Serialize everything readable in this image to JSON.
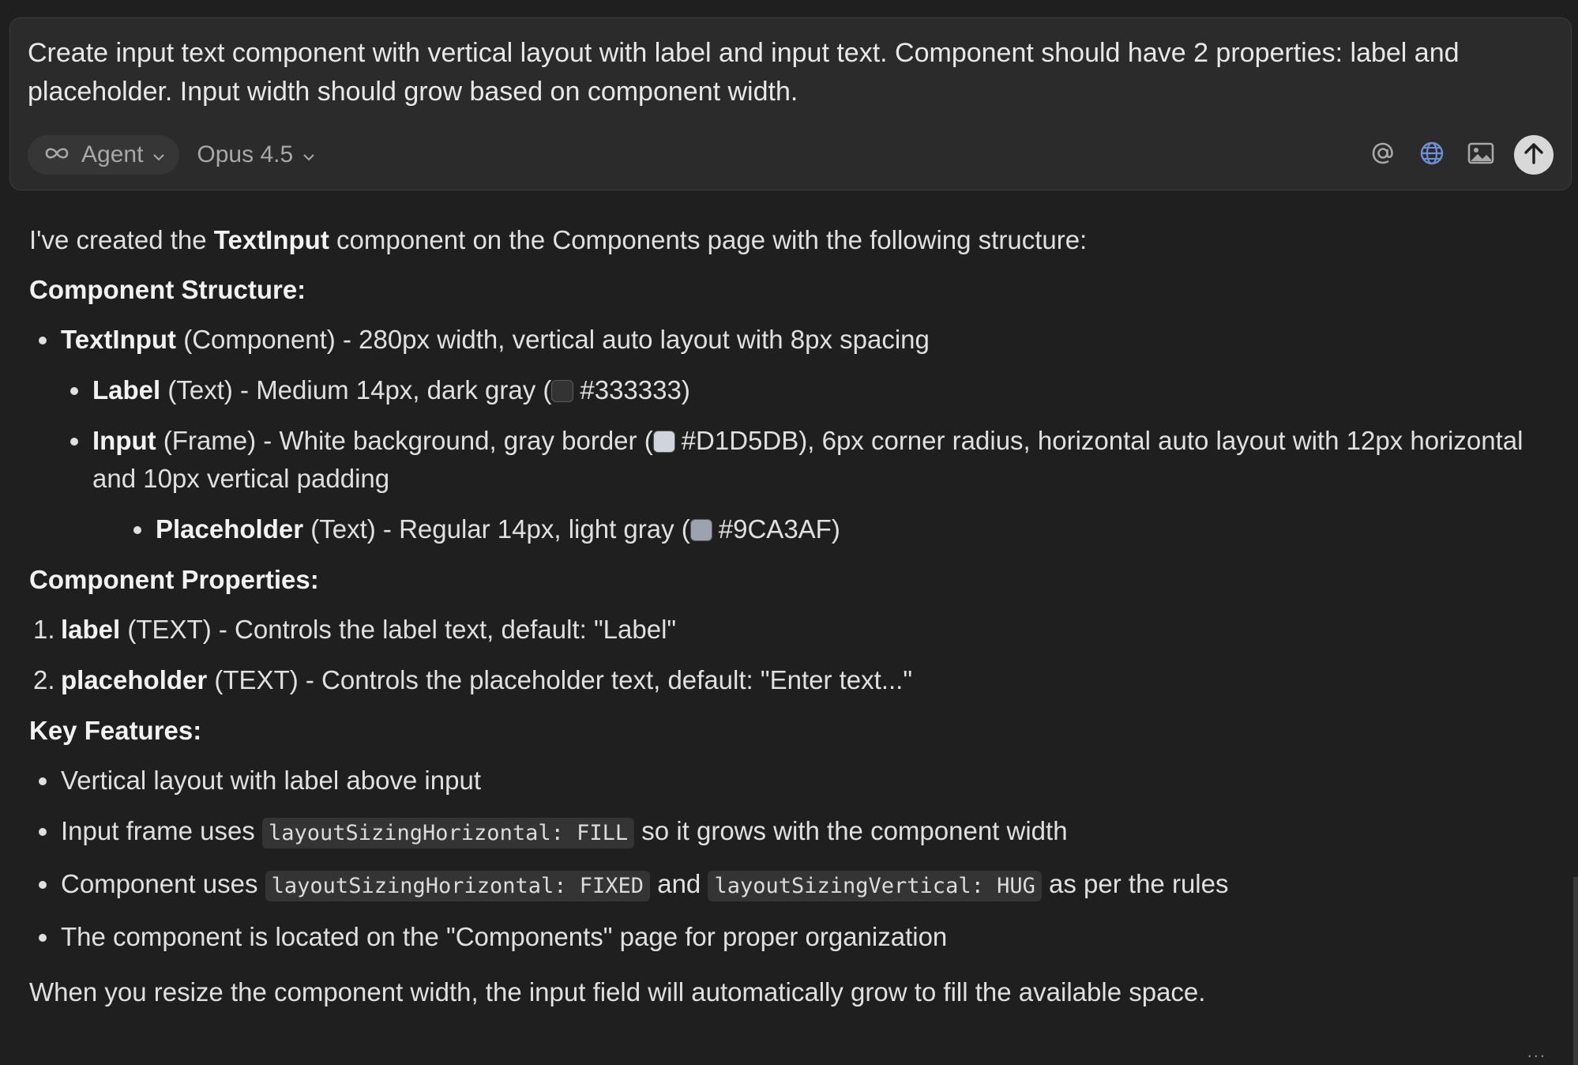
{
  "composer": {
    "prompt": "Create input text component with vertical layout with label and input text. Component should have 2 properties: label and placeholder. Input width should grow based on component width.",
    "mode_label": "Agent",
    "mode_icon": "infinity-icon",
    "model_label": "Opus 4.5",
    "icons": [
      "at-icon",
      "globe-icon",
      "image-icon",
      "arrow-up-icon"
    ]
  },
  "response": {
    "intro_pre": "I've created the ",
    "intro_bold": "TextInput",
    "intro_post": " component on the Components page with the following structure:",
    "structure_heading": "Component Structure:",
    "structure": {
      "root_name": "TextInput",
      "root_desc": " (Component) - 280px width, vertical auto layout with 8px spacing",
      "label_name": "Label",
      "label_desc_pre": " (Text) - Medium 14px, dark gray (",
      "label_color": "#333333",
      "label_desc_post": ")",
      "input_name": "Input",
      "input_desc_pre": " (Frame) - White background, gray border (",
      "input_color": "#D1D5DB",
      "input_desc_post": "), 6px corner radius, horizontal auto layout with 12px horizontal and 10px vertical padding",
      "placeholder_name": "Placeholder",
      "placeholder_desc_pre": " (Text) - Regular 14px, light gray (",
      "placeholder_color": "#9CA3AF",
      "placeholder_desc_post": ")"
    },
    "properties_heading": "Component Properties:",
    "properties": [
      {
        "num": "1.",
        "name": "label",
        "desc": " (TEXT) - Controls the label text, default: \"Label\""
      },
      {
        "num": "2.",
        "name": "placeholder",
        "desc": " (TEXT) - Controls the placeholder text, default: \"Enter text...\""
      }
    ],
    "features_heading": "Key Features:",
    "features": {
      "f1": "Vertical layout with label above input",
      "f2_pre": "Input frame uses ",
      "f2_code": "layoutSizingHorizontal: FILL",
      "f2_post": " so it grows with the component width",
      "f3_pre": "Component uses ",
      "f3_code1": "layoutSizingHorizontal: FIXED",
      "f3_mid": " and ",
      "f3_code2": "layoutSizingVertical: HUG",
      "f3_post": " as per the rules",
      "f4": "The component is located on the \"Components\" page for proper organization"
    },
    "closing": "When you resize the component width, the input field will automatically grow to fill the available space.",
    "more": "..."
  }
}
